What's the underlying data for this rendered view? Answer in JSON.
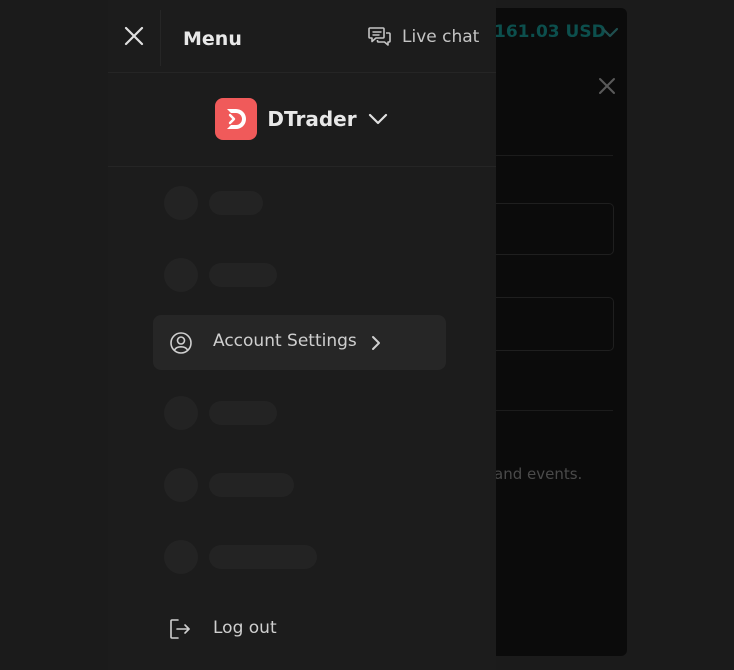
{
  "background": {
    "balance_text": "161.03 USD",
    "body_text": "and events.",
    "close_icon": "close-icon",
    "chevron_icon": "chevron-down-icon"
  },
  "menu": {
    "title": "Menu",
    "close_icon": "close-icon",
    "live_chat": {
      "label": "Live chat",
      "icon": "chat-bubbles-icon"
    },
    "platform": {
      "name": "DTrader",
      "logo_color": "#f05a5a",
      "icon": "dtrader-logo",
      "chevron_icon": "chevron-down-icon"
    },
    "items": {
      "account_settings": {
        "label": "Account Settings",
        "icon": "user-circle-icon",
        "chevron_icon": "chevron-right-icon"
      },
      "loading_placeholders_count": 5
    },
    "logout": {
      "label": "Log out",
      "icon": "logout-icon"
    }
  },
  "colors": {
    "panel_bg": "#1c1c1c",
    "highlight_bg": "#262626",
    "text_primary": "#e8e8e8",
    "text_secondary": "#cfcfcf",
    "brand_red": "#f05a5a",
    "balance_teal": "#0c4f4d"
  }
}
